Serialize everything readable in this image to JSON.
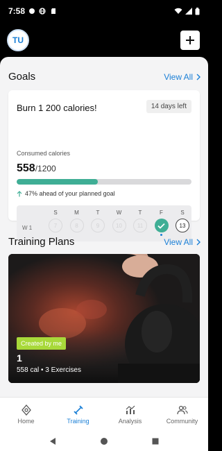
{
  "status_bar": {
    "time": "7:58"
  },
  "header": {
    "avatar_initials": "TU"
  },
  "goals": {
    "title": "Goals",
    "view_all": "View All",
    "card": {
      "title": "Burn 1 200 calories!",
      "days_left": "14 days left",
      "consumed_label": "Consumed calories",
      "consumed_value": "558",
      "consumed_target": "/1200",
      "progress_fraction": 0.465,
      "ahead_text": "47% ahead of your planned goal",
      "week_label": "W 1",
      "days": [
        {
          "letter": "S",
          "num": "7",
          "state": "past"
        },
        {
          "letter": "M",
          "num": "8",
          "state": "past"
        },
        {
          "letter": "T",
          "num": "9",
          "state": "past"
        },
        {
          "letter": "W",
          "num": "10",
          "state": "past"
        },
        {
          "letter": "T",
          "num": "11",
          "state": "past"
        },
        {
          "letter": "F",
          "num": "",
          "state": "done"
        },
        {
          "letter": "S",
          "num": "13",
          "state": "today"
        }
      ]
    }
  },
  "training_plans": {
    "title": "Training Plans",
    "view_all": "View All",
    "plan": {
      "badge": "Created by me",
      "name": "1",
      "meta": "558 cal • 3 Exercises"
    }
  },
  "bottom_nav": [
    {
      "label": "Home",
      "icon": "home-icon",
      "active": false
    },
    {
      "label": "Training",
      "icon": "dumbbell-icon",
      "active": true
    },
    {
      "label": "Analysis",
      "icon": "chart-icon",
      "active": false
    },
    {
      "label": "Community",
      "icon": "people-icon",
      "active": false
    }
  ],
  "colors": {
    "accent": "#1a7fd6",
    "progress": "#3fae95",
    "badge": "#a8d93a"
  }
}
